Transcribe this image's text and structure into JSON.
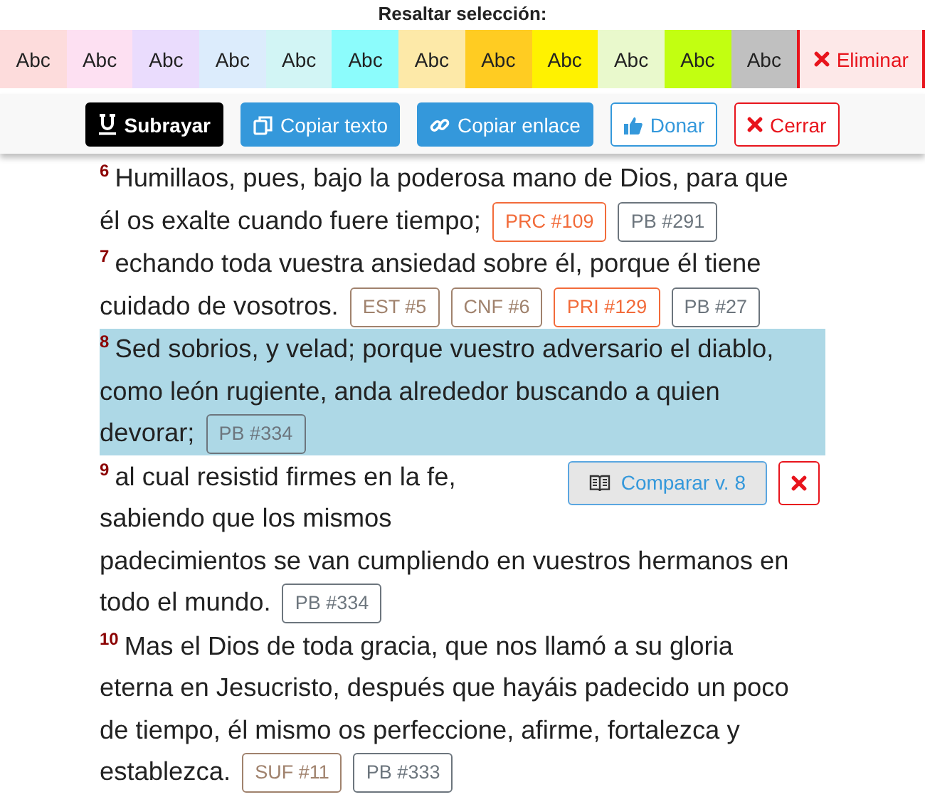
{
  "highlight_bar": {
    "title": "Resaltar selección:",
    "swatches": [
      {
        "label": "Abc",
        "color": "#fddcdc"
      },
      {
        "label": "Abc",
        "color": "#fde0f2"
      },
      {
        "label": "Abc",
        "color": "#eadcfd"
      },
      {
        "label": "Abc",
        "color": "#dcecfc"
      },
      {
        "label": "Abc",
        "color": "#d2f5f5"
      },
      {
        "label": "Abc",
        "color": "#8cfcfc"
      },
      {
        "label": "Abc",
        "color": "#fde9a8"
      },
      {
        "label": "Abc",
        "color": "#ffcc22"
      },
      {
        "label": "Abc",
        "color": "#fff200"
      },
      {
        "label": "Abc",
        "color": "#e9f9cc"
      },
      {
        "label": "Abc",
        "color": "#c2ff11"
      },
      {
        "label": "Abc",
        "color": "#c0c0c0"
      }
    ],
    "remove_button": "Eliminar"
  },
  "toolbar": [
    {
      "label": "Subrayar",
      "kind": "dark"
    },
    {
      "label": "Copiar texto",
      "kind": "primary"
    },
    {
      "label": "Copiar enlace",
      "kind": "primary"
    },
    {
      "label": "Donar",
      "kind": "outline-primary"
    },
    {
      "label": "Cerrar",
      "kind": "outline-danger"
    }
  ],
  "verses": [
    {
      "number": "6",
      "lines": [
        "Humillaos, pues, bajo la poderosa mano de Dios, para que",
        "él os exalte cuando fuere tiempo;"
      ],
      "highlighted": false,
      "refs": [
        {
          "label": "PRC #109",
          "color": "#f26b3a"
        },
        {
          "label": "PB #291",
          "color": "#6c757d"
        }
      ]
    },
    {
      "number": "7",
      "lines": [
        "echando toda vuestra ansiedad sobre él, porque él tiene",
        "cuidado de vosotros."
      ],
      "highlighted": false,
      "refs": [
        {
          "label": "EST #5",
          "color": "#a0826d"
        },
        {
          "label": "CNF #6",
          "color": "#a0826d"
        },
        {
          "label": "PRI #129",
          "color": "#f26b3a"
        },
        {
          "label": "PB #27",
          "color": "#6c757d"
        }
      ]
    },
    {
      "number": "8",
      "lines": [
        "Sed sobrios, y velad; porque vuestro adversario el diablo,",
        "como león rugiente, anda alrededor buscando a quien",
        "devorar;"
      ],
      "highlighted": true,
      "refs": [
        {
          "label": "PB #334",
          "color": "#6c757d"
        }
      ]
    },
    {
      "number": "9",
      "lines": [
        "al cual resistid firmes en la fe,",
        "sabiendo que los mismos",
        "padecimientos se van cumpliendo en vuestros hermanos en",
        "todo el mundo."
      ],
      "highlighted": false,
      "compare_button": "Comparar v. 8",
      "refs": [
        {
          "label": "PB #334",
          "color": "#6c757d"
        }
      ]
    },
    {
      "number": "10",
      "lines": [
        "Mas el Dios de toda gracia, que nos llamó a su gloria",
        "eterna en Jesucristo, después que hayáis padecido un poco",
        "de tiempo, él mismo os perfeccione, afirme, fortalezca y",
        "establezca."
      ],
      "highlighted": false,
      "refs": [
        {
          "label": "SUF #11",
          "color": "#a0826d"
        },
        {
          "label": "PB #333",
          "color": "#6c757d"
        }
      ]
    }
  ]
}
